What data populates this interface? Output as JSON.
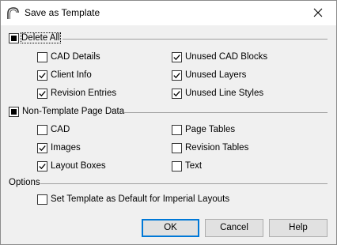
{
  "window": {
    "title": "Save as Template"
  },
  "groups": [
    {
      "label": "Delete All",
      "state": "indeterminate",
      "items": [
        {
          "label": "CAD Details",
          "checked": false
        },
        {
          "label": "Unused CAD Blocks",
          "checked": true
        },
        {
          "label": "Client Info",
          "checked": true
        },
        {
          "label": "Unused Layers",
          "checked": true
        },
        {
          "label": "Revision Entries",
          "checked": true
        },
        {
          "label": "Unused Line Styles",
          "checked": true
        }
      ]
    },
    {
      "label": "Non-Template Page Data",
      "state": "indeterminate",
      "items": [
        {
          "label": "CAD",
          "checked": false
        },
        {
          "label": "Page Tables",
          "checked": false
        },
        {
          "label": "Images",
          "checked": true
        },
        {
          "label": "Revision Tables",
          "checked": false
        },
        {
          "label": "Layout Boxes",
          "checked": true
        },
        {
          "label": "Text",
          "checked": false
        }
      ]
    }
  ],
  "options": {
    "label": "Options",
    "items": [
      {
        "label": "Set Template as Default for Imperial Layouts",
        "checked": false
      }
    ]
  },
  "buttons": {
    "ok": "OK",
    "cancel": "Cancel",
    "help": "Help"
  },
  "colors": {
    "accent": "#0078d7",
    "background": "#f0f0f0"
  },
  "icons": {
    "app": "arch-icon",
    "close": "close-icon",
    "check": "checkmark-icon"
  }
}
